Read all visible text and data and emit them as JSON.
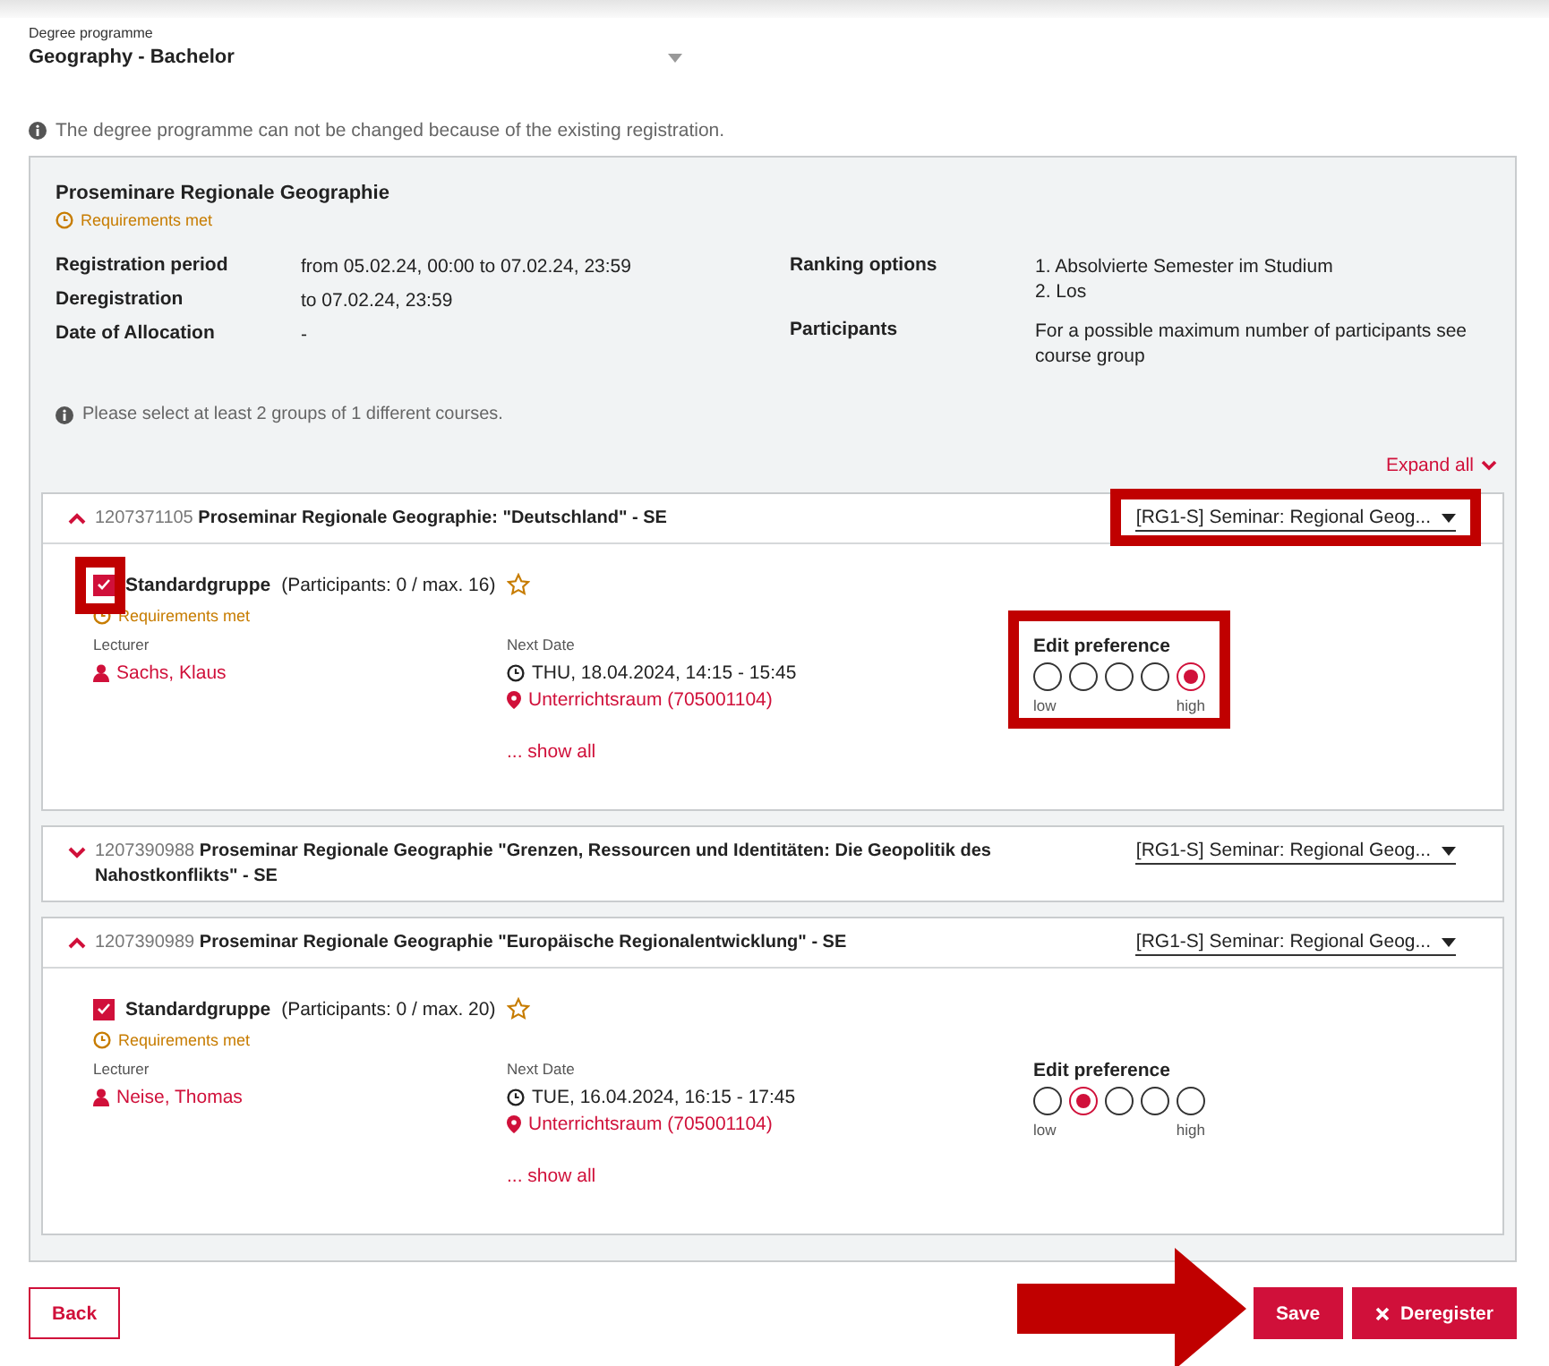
{
  "degree_programme": {
    "label": "Degree programme",
    "value": "Geography - Bachelor"
  },
  "notice": "The degree programme can not be changed because of the existing registration.",
  "module": {
    "title": "Proseminare Regionale Geographie",
    "requirements": "Requirements met",
    "details_left": [
      {
        "label": "Registration period",
        "value": "from 05.02.24, 00:00 to 07.02.24, 23:59"
      },
      {
        "label": "Deregistration",
        "value": "to 07.02.24, 23:59"
      },
      {
        "label": "Date of Allocation",
        "value": "-"
      }
    ],
    "details_right": [
      {
        "label": "Ranking options",
        "lines": [
          "1. Absolvierte Semester im Studium",
          "2. Los"
        ]
      },
      {
        "label": "Participants",
        "lines": [
          "For a possible maximum number of participants see course group"
        ]
      }
    ],
    "hint": "Please select at least 2 groups of 1 different courses.",
    "expand_all": "Expand all",
    "courses": [
      {
        "number": "1207371105",
        "title": "Proseminar Regionale Geographie: \"Deutschland\" - SE",
        "expanded": true,
        "group_select": "[RG1-S]  Seminar: Regional Geog...",
        "highlighted": true,
        "group": {
          "name": "Standardgruppe",
          "participants": "(Participants: 0 / max. 16)",
          "checked": true,
          "checkbox_highlighted": true,
          "requirements": "Requirements met",
          "lecturer_label": "Lecturer",
          "lecturer": "Sachs, Klaus",
          "next_date_label": "Next Date",
          "date": "THU, 18.04.2024, 14:15 - 15:45",
          "room": "Unterrichtsraum (705001104)",
          "show_all": "... show all",
          "preference_label": "Edit preference",
          "preference_highlighted": true,
          "preference": [
            {
              "selected": false
            },
            {
              "selected": false
            },
            {
              "selected": false
            },
            {
              "selected": false
            },
            {
              "selected": true
            }
          ],
          "low": "low",
          "high": "high"
        }
      },
      {
        "number": "1207390988",
        "title": "Proseminar Regionale Geographie \"Grenzen, Ressourcen und Identitäten: Die Geopolitik des Nahostkonflikts\" - SE",
        "expanded": false,
        "group_select": "[RG1-S]  Seminar: Regional Geog...",
        "highlighted": false
      },
      {
        "number": "1207390989",
        "title": "Proseminar Regionale Geographie \"Europäische Regionalentwicklung\" - SE",
        "expanded": true,
        "group_select": "[RG1-S]  Seminar: Regional Geog...",
        "highlighted": false,
        "group": {
          "name": "Standardgruppe",
          "participants": "(Participants: 0 / max. 20)",
          "checked": true,
          "checkbox_highlighted": false,
          "requirements": "Requirements met",
          "lecturer_label": "Lecturer",
          "lecturer": "Neise, Thomas",
          "next_date_label": "Next Date",
          "date": "TUE, 16.04.2024, 16:15 - 17:45",
          "room": "Unterrichtsraum (705001104)",
          "show_all": "... show all",
          "preference_label": "Edit preference",
          "preference_highlighted": false,
          "preference": [
            {
              "selected": false
            },
            {
              "selected": true
            },
            {
              "selected": false
            },
            {
              "selected": false
            },
            {
              "selected": false
            }
          ],
          "low": "low",
          "high": "high"
        }
      }
    ]
  },
  "save_arrow": true,
  "buttons": [
    {
      "label": "Back",
      "kind": "outline"
    },
    {
      "label": "Save",
      "kind": "primary"
    },
    {
      "label": "Deregister",
      "kind": "danger"
    }
  ]
}
